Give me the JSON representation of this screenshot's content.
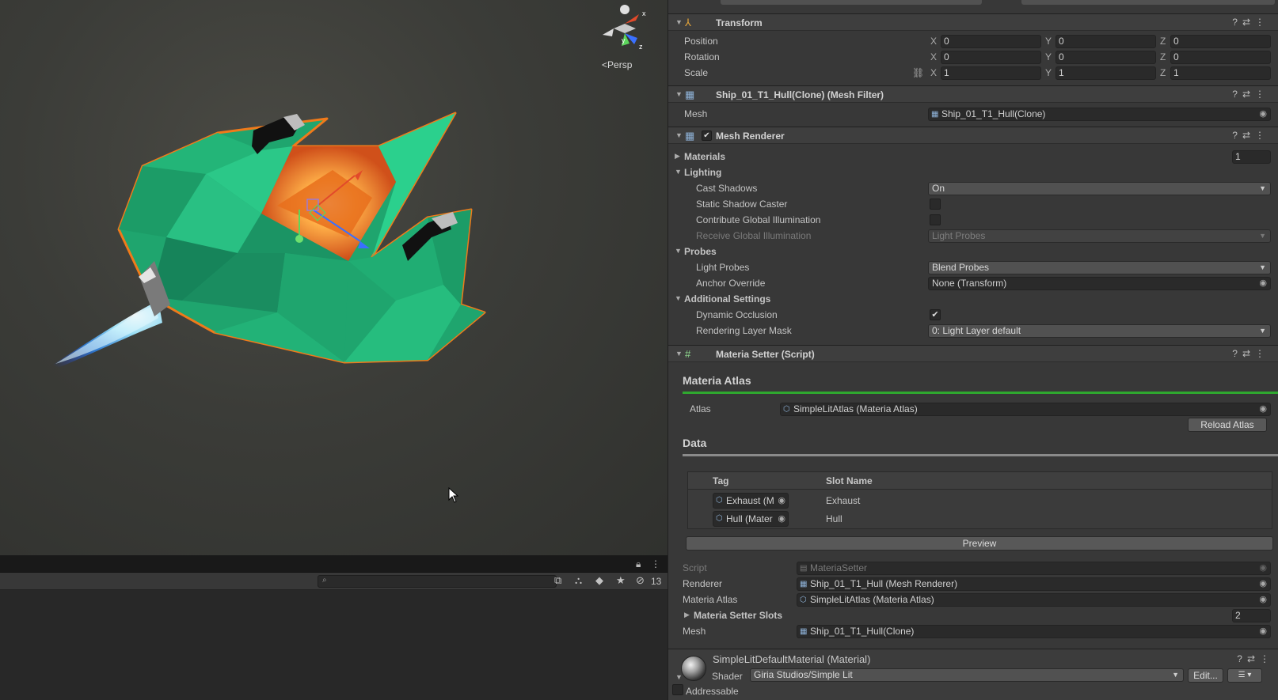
{
  "scene": {
    "persp_label": "Persp",
    "gizmo_axes": {
      "x": "x",
      "y": "y",
      "z": "z"
    }
  },
  "bottom_panel": {
    "search_placeholder": "",
    "hidden_count": "13"
  },
  "transform": {
    "title": "Transform",
    "rows": [
      {
        "label": "Position",
        "x": "0",
        "y": "0",
        "z": "0"
      },
      {
        "label": "Rotation",
        "x": "0",
        "y": "0",
        "z": "0"
      },
      {
        "label": "Scale",
        "x": "1",
        "y": "1",
        "z": "1"
      }
    ],
    "axis_labels": {
      "x": "X",
      "y": "Y",
      "z": "Z"
    }
  },
  "mesh_filter": {
    "title": "Ship_01_T1_Hull(Clone) (Mesh Filter)",
    "mesh_label": "Mesh",
    "mesh_value": "Ship_01_T1_Hull(Clone)"
  },
  "mesh_renderer": {
    "title": "Mesh Renderer",
    "enabled": true,
    "materials_label": "Materials",
    "materials_count": "1",
    "lighting_label": "Lighting",
    "cast_shadows_label": "Cast Shadows",
    "cast_shadows_value": "On",
    "static_shadow_label": "Static Shadow Caster",
    "contribute_gi_label": "Contribute Global Illumination",
    "receive_gi_label": "Receive Global Illumination",
    "receive_gi_value": "Light Probes",
    "probes_label": "Probes",
    "light_probes_label": "Light Probes",
    "light_probes_value": "Blend Probes",
    "anchor_override_label": "Anchor Override",
    "anchor_override_value": "None (Transform)",
    "additional_label": "Additional Settings",
    "dynamic_occlusion_label": "Dynamic Occlusion",
    "dynamic_occlusion_checked": true,
    "rendering_layer_label": "Rendering Layer Mask",
    "rendering_layer_value": "0: Light Layer default"
  },
  "materia_setter": {
    "title": "Materia Setter (Script)",
    "atlas_section": "Materia Atlas",
    "atlas_label": "Atlas",
    "atlas_value": "SimpleLitAtlas (Materia Atlas)",
    "reload_button": "Reload Atlas",
    "data_section": "Data",
    "table_headers": {
      "tag": "Tag",
      "slot_name": "Slot Name"
    },
    "table_rows": [
      {
        "tag": "Exhaust (M",
        "slot": "Exhaust"
      },
      {
        "tag": "Hull (Mater",
        "slot": "Hull"
      }
    ],
    "preview_button": "Preview",
    "script_label": "Script",
    "script_value": "MateriaSetter",
    "renderer_label": "Renderer",
    "renderer_value": "Ship_01_T1_Hull (Mesh Renderer)",
    "materia_atlas_label": "Materia Atlas",
    "materia_atlas_value": "SimpleLitAtlas (Materia Atlas)",
    "slots_label": "Materia Setter Slots",
    "slots_count": "2",
    "mesh_label": "Mesh",
    "mesh_value": "Ship_01_T1_Hull(Clone)"
  },
  "material": {
    "title": "SimpleLitDefaultMaterial (Material)",
    "shader_label": "Shader",
    "shader_value": "Giria Studios/Simple Lit",
    "edit_button": "Edit...",
    "addressable_label": "Addressable"
  },
  "colors": {
    "atlas_underline": "#2fa82f",
    "data_underline": "#8a8a8a",
    "selection_outline": "#f07a1a",
    "hull_green": "#1fa56e"
  }
}
